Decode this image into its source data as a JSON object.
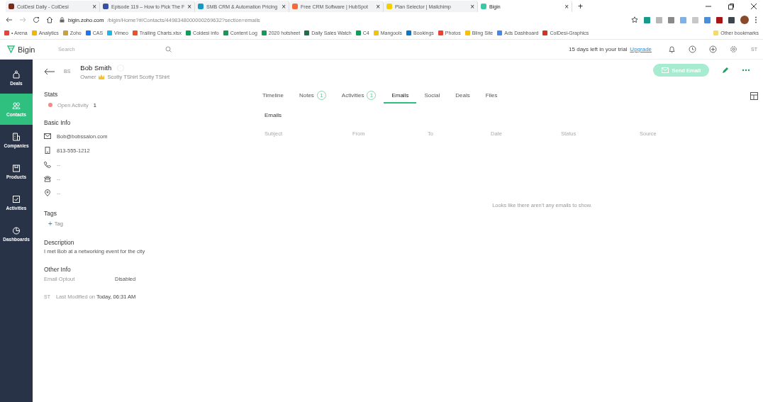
{
  "browser": {
    "tabs": [
      {
        "title": "ColDesi Daily - ColDesi",
        "selected": false,
        "color": "#7a2a1a"
      },
      {
        "title": "Episode 119 – How to Pick The F",
        "selected": false,
        "color": "#3b4fa0"
      },
      {
        "title": "SMB CRM & Automation Pricing",
        "selected": false,
        "color": "#1798c1"
      },
      {
        "title": "Free CRM Software | HubSpot",
        "selected": false,
        "color": "#f26b3a"
      },
      {
        "title": "Plan Selector | Mailchimp",
        "selected": false,
        "color": "#f5d000"
      },
      {
        "title": "Bigin",
        "selected": true,
        "color": "#3cc7a8"
      }
    ],
    "close_glyph": "×",
    "new_tab": "+",
    "url_host": "bigin.zoho.com",
    "url_path": "/bigin/Home?#/Contacts/4498348000000269632?section=emails",
    "bookmarks": [
      {
        "label": "• Arena",
        "color": "#e0443a"
      },
      {
        "label": "Analytics",
        "color": "#f4b400"
      },
      {
        "label": "Zoho",
        "color": "#c9a23a"
      },
      {
        "label": "CAS",
        "color": "#1877f2"
      },
      {
        "label": "Vimeo",
        "color": "#1ab7ea"
      },
      {
        "label": "Trailing Charts.xlsx",
        "color": "#f25022"
      },
      {
        "label": "Coldesi info",
        "color": "#0f9d58"
      },
      {
        "label": "Content Log",
        "color": "#0f9d58"
      },
      {
        "label": "2020 hotsheet",
        "color": "#0f9d58"
      },
      {
        "label": "Daily Sales Watch",
        "color": "#1d7044"
      },
      {
        "label": "C4",
        "color": "#0f9d58"
      },
      {
        "label": "Mangools",
        "color": "#f4c20d"
      },
      {
        "label": "Bookings",
        "color": "#0078d4"
      },
      {
        "label": "Photos",
        "color": "#ea4335"
      },
      {
        "label": "Bling Site",
        "color": "#f4c20d"
      },
      {
        "label": "Ads Dashboard",
        "color": "#4285f4"
      },
      {
        "label": "ColDesi-Graphics",
        "color": "#d93025"
      }
    ],
    "other_bookmarks": "Other bookmarks"
  },
  "app": {
    "logo": "Bigin",
    "search_placeholder": "Search",
    "trial_text": "15 days left in your trial",
    "upgrade": "Upgrade",
    "avatar": "ST"
  },
  "sidebar": [
    {
      "label": "Deals",
      "kind": "deals",
      "selected": false
    },
    {
      "label": "Contacts",
      "kind": "contacts",
      "selected": true
    },
    {
      "label": "Companies",
      "kind": "companies",
      "selected": false
    },
    {
      "label": "Products",
      "kind": "products",
      "selected": false
    },
    {
      "label": "Activities",
      "kind": "activities",
      "selected": false
    },
    {
      "label": "Dashboards",
      "kind": "dashboards",
      "selected": false
    }
  ],
  "contact": {
    "initials": "BS",
    "name": "Bob Smith",
    "owner_label": "Owner",
    "owner": "Scotty TShirt Scotty TShirt",
    "send_email": {
      "label": "Send Email",
      "disabled": true
    }
  },
  "stats": {
    "title": "Stats",
    "items": [
      {
        "label": "Open Activity",
        "value": "1",
        "color": "#f08a8a"
      }
    ]
  },
  "basic_info": {
    "title": "Basic Info",
    "items": [
      {
        "kind": "email",
        "value": "Bob@bobssalon.com"
      },
      {
        "kind": "mobile",
        "value": "813-555-1212"
      },
      {
        "kind": "phone",
        "value": "--"
      },
      {
        "kind": "fax",
        "value": "--"
      },
      {
        "kind": "location",
        "value": "--"
      }
    ]
  },
  "tags": {
    "title": "Tags",
    "add_glyph": "+",
    "add": "Tag"
  },
  "description": {
    "title": "Description",
    "text": "I met Bob at a networking event for the city"
  },
  "other_info": {
    "title": "Other Info",
    "rows": [
      {
        "label": "Email Optout",
        "value": "Disabled"
      }
    ]
  },
  "modified": {
    "initials": "ST",
    "text": "Last Modified on **Today, 06:31 AM**"
  },
  "detail_tabs": [
    {
      "label": "Timeline",
      "selected": false
    },
    {
      "label": "Notes",
      "count": "1",
      "selected": false
    },
    {
      "label": "Activities",
      "count": "1",
      "selected": false
    },
    {
      "label": "Emails",
      "selected": true
    },
    {
      "label": "Social",
      "selected": false
    },
    {
      "label": "Deals",
      "selected": false
    },
    {
      "label": "Files",
      "selected": false
    }
  ],
  "emails": {
    "title": "Emails",
    "columns": [
      "Subject",
      "From",
      "To",
      "Date",
      "Status",
      "Source"
    ],
    "empty": "Looks like there aren't any emails to show."
  }
}
